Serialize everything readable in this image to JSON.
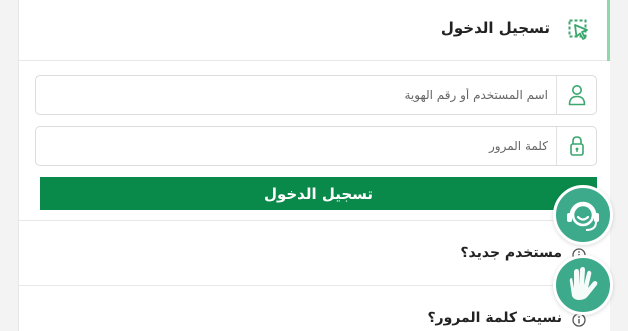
{
  "header": {
    "title": "تسجيل الدخول",
    "icon": "pointer-click-icon",
    "accent_color": "#8fd9a8"
  },
  "form": {
    "username": {
      "placeholder": "اسم المستخدم أو رقم الهوية",
      "value": "",
      "icon": "user-icon"
    },
    "password": {
      "placeholder": "كلمة المرور",
      "value": "",
      "icon": "lock-icon"
    },
    "submit_label": "تسجيل الدخول",
    "submit_color": "#0a8a4a"
  },
  "links": {
    "new_user": "مستخدم جديد؟",
    "forgot_password": "نسيت كلمة المرور؟"
  },
  "floating": {
    "support_icon": "customer-support-icon",
    "sign_language_icon": "sign-language-icon",
    "color": "#3eaa8c"
  }
}
